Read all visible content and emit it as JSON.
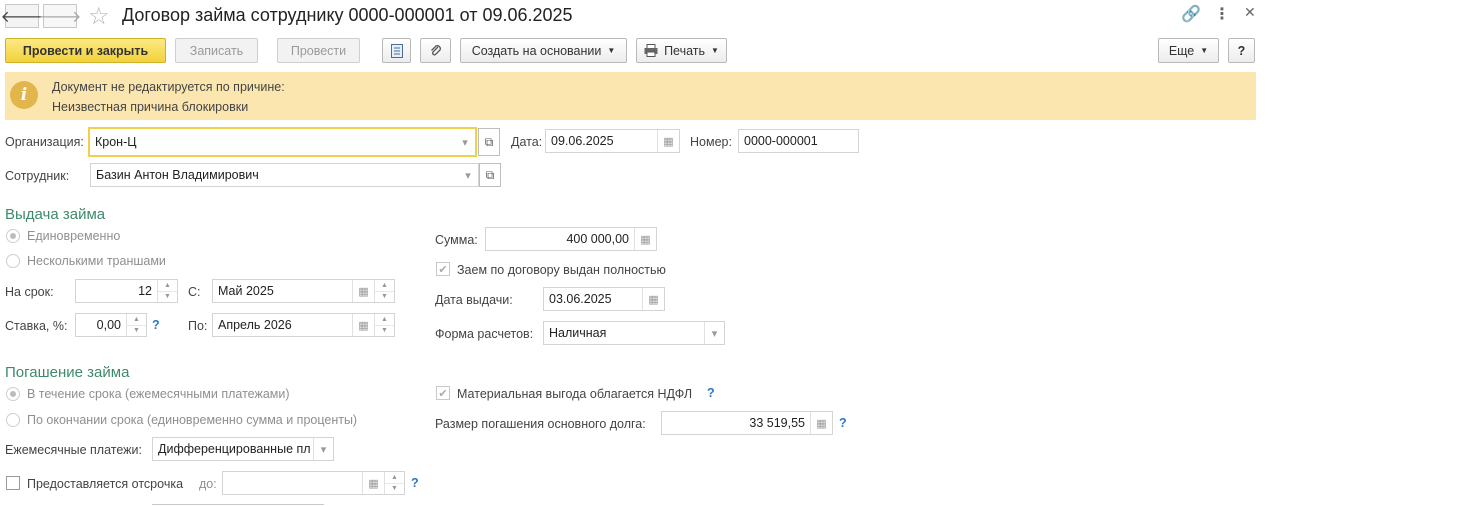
{
  "window": {
    "title": "Договор займа сотруднику 0000-000001 от 09.06.2025",
    "back_glyph": "🡐",
    "forward_glyph": "🡒",
    "star_glyph": "☆",
    "link_glyph": "🔗",
    "more_glyph": "⋮",
    "close_glyph": "✕"
  },
  "toolbar": {
    "post_and_close": "Провести и закрыть",
    "save": "Записать",
    "post": "Провести",
    "create_based_on": "Создать на основании",
    "print": "Печать",
    "more": "Еще",
    "help": "?"
  },
  "info_bar": {
    "line1": "Документ не редактируется по причине:",
    "line2": "Неизвестная причина блокировки",
    "icon": "i"
  },
  "header_fields": {
    "organization_label": "Организация:",
    "organization_value": "Крон-Ц",
    "date_label": "Дата:",
    "date_value": "09.06.2025",
    "number_label": "Номер:",
    "number_value": "0000-000001",
    "employee_label": "Сотрудник:",
    "employee_value": "Базин Антон Владимирович"
  },
  "issue_section": {
    "title": "Выдача займа",
    "radio_once": "Единовременно",
    "radio_tranches": "Несколькими траншами",
    "term_label": "На срок:",
    "term_value": "12",
    "from_label": "С:",
    "from_value": "Май 2025",
    "rate_label": "Ставка, %:",
    "rate_value": "0,00",
    "to_label": "По:",
    "to_value": "Апрель 2026",
    "amount_label": "Сумма:",
    "amount_value": "400 000,00",
    "fully_issued_label": "Заем по договору выдан полностью",
    "issue_date_label": "Дата выдачи:",
    "issue_date_value": "03.06.2025",
    "payment_form_label": "Форма расчетов:",
    "payment_form_value": "Наличная"
  },
  "repay_section": {
    "title": "Погашение займа",
    "radio_monthly": "В течение срока (ежемесячными платежами)",
    "radio_end": "По окончании срока (единовременно сумма и проценты)",
    "monthly_payments_label": "Ежемесячные платежи:",
    "monthly_payments_value": "Дифференцированные пл",
    "deferral_label": "Предоставляется отсрочка",
    "deferral_to_label": "до:",
    "deferral_to_value": "",
    "ndfl_label": "Материальная выгода облагается НДФЛ",
    "principal_label": "Размер погашения основного долга:",
    "principal_value": "33 519,55"
  },
  "help_mark": "?"
}
